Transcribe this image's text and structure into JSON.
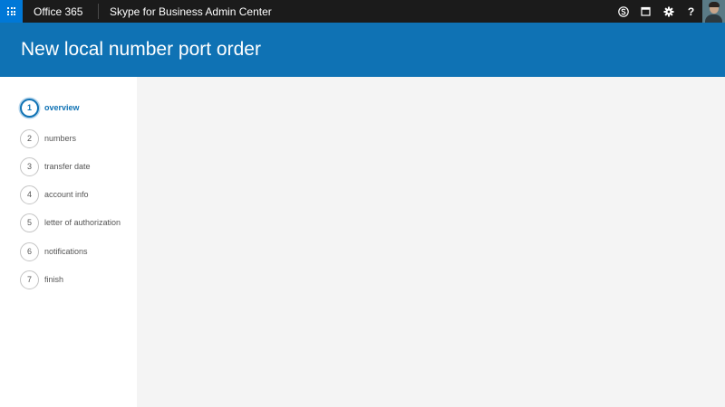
{
  "topbar": {
    "brand": "Office 365",
    "app_title": "Skype for Business Admin Center",
    "icons": [
      "skype-icon",
      "calendar-icon",
      "gear-icon",
      "help-icon"
    ]
  },
  "header": {
    "title": "New local number port order"
  },
  "steps": [
    {
      "number": "1",
      "label": "overview",
      "active": true
    },
    {
      "number": "2",
      "label": "numbers",
      "active": false
    },
    {
      "number": "3",
      "label": "transfer date",
      "active": false
    },
    {
      "number": "4",
      "label": "account info",
      "active": false
    },
    {
      "number": "5",
      "label": "letter of authorization",
      "active": false
    },
    {
      "number": "6",
      "label": "notifications",
      "active": false
    },
    {
      "number": "7",
      "label": "finish",
      "active": false
    }
  ],
  "colors": {
    "topbar_bg": "#1b1b1b",
    "waffle_bg": "#0078d7",
    "header_bg": "#0f72b4",
    "active_step": "#0f72b4",
    "main_bg": "#f4f4f4"
  }
}
